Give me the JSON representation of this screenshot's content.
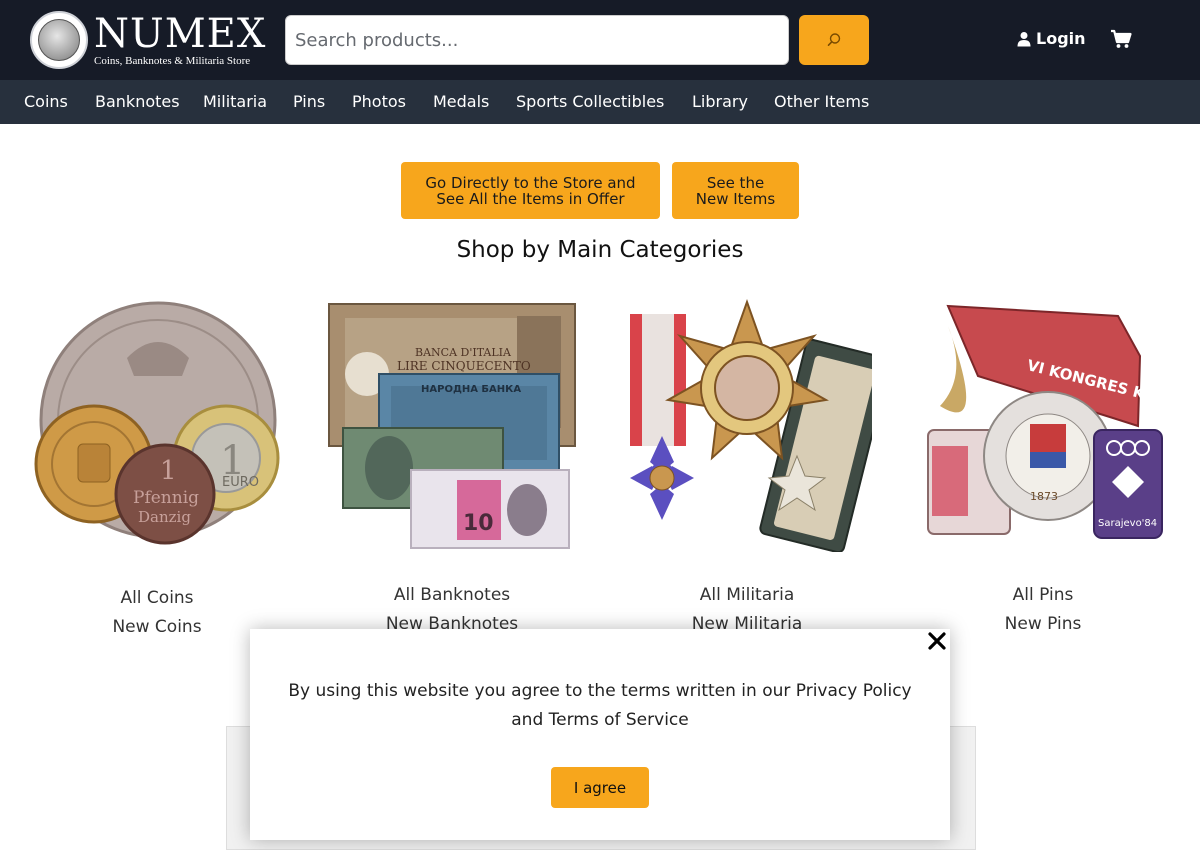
{
  "header": {
    "brand_name": "NUMEX",
    "brand_tagline": "Coins, Banknotes & Militaria Store",
    "logo_icon": "coin-portrait-logo",
    "search": {
      "placeholder": "Search products...",
      "value": "",
      "button_icon": "search-icon"
    },
    "login_label": "Login",
    "login_icon": "user-icon",
    "cart_icon": "cart-icon",
    "colors": {
      "top_bar": "#161b27",
      "nav_bar": "#27303d",
      "accent": "#f7a61c"
    }
  },
  "nav": {
    "items": [
      {
        "label": "Coins"
      },
      {
        "label": "Banknotes"
      },
      {
        "label": "Militaria"
      },
      {
        "label": "Pins"
      },
      {
        "label": "Photos"
      },
      {
        "label": "Medals"
      },
      {
        "label": "Sports Collectibles"
      },
      {
        "label": "Library"
      },
      {
        "label": "Other Items"
      }
    ]
  },
  "main": {
    "cta_store": {
      "line1": "Go Directly to the Store and",
      "line2": "See All the Items in Offer"
    },
    "cta_new": {
      "line1": "See the",
      "line2": "New Items"
    },
    "section_title": "Shop by Main Categories",
    "categories": [
      {
        "all_label": "All Coins",
        "new_label": "New Coins",
        "image": "coins-image"
      },
      {
        "all_label": "All Banknotes",
        "new_label": "New Banknotes",
        "image": "banknotes-image"
      },
      {
        "all_label": "All Militaria",
        "new_label": "New Militaria",
        "image": "militaria-image"
      },
      {
        "all_label": "All Pins",
        "new_label": "New Pins",
        "image": "pins-image"
      }
    ],
    "banknote_texts": [
      "BANCA D'ITALIA",
      "LIRE CINQUECENTO",
      "НАРОДНА БАНКА",
      "10"
    ],
    "coin_texts": [
      "1",
      "Pfennig",
      "Danzig",
      "EURO"
    ],
    "pin_texts": [
      "VI KONGRES KPJ",
      "Sarajevo'84",
      "1873"
    ]
  },
  "cookie_modal": {
    "text_line1": "By using this website you agree to the terms written in our Privacy Policy",
    "text_line2": "and Terms of Service",
    "agree_label": "I agree",
    "close_icon": "close-icon"
  }
}
